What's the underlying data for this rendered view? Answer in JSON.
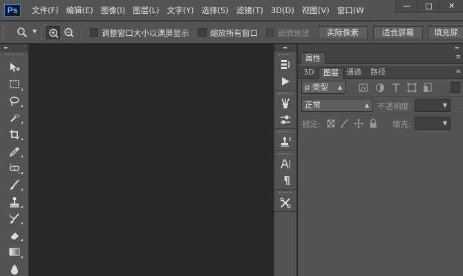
{
  "app": {
    "logo": "Ps"
  },
  "menu": {
    "items": [
      "文件(F)",
      "编辑(E)",
      "图像(I)",
      "图层(L)",
      "文字(Y)",
      "选择(S)",
      "滤镜(T)",
      "3D(D)",
      "视图(V)",
      "窗口(W"
    ]
  },
  "window": {
    "minimize": "—",
    "restore": "□",
    "close": "✕"
  },
  "options": {
    "tool_arrow": "▼",
    "resize_windows_label": "调整窗口大小以满屏显示",
    "zoom_all_windows_label": "缩放所有窗口",
    "scrubby_zoom_label": "细微缩放",
    "actual_pixels_button": "实际像素",
    "fit_screen_button": "适合屏幕",
    "fill_screen_button": "填充屏"
  },
  "tools_panel": {
    "collapse": "▸▸"
  },
  "dock": {
    "collapse": "◂◂"
  },
  "right_panel": {
    "collapse": "▸▸"
  },
  "properties_panel": {
    "tab": "属性",
    "menu": "≡"
  },
  "layers_panel": {
    "tabs": [
      "3D",
      "图层",
      "通道",
      "路径"
    ],
    "menu": "≡",
    "filter_kind": "ρ 类型",
    "blend_mode": "正常",
    "opacity_label": "不透明度:",
    "lock_label": "锁定:",
    "fill_label": "填充:"
  },
  "colors": {
    "chrome": "#535353",
    "canvas": "#282828",
    "panel_header": "#424242",
    "ps_blue": "#6fb3ff"
  }
}
